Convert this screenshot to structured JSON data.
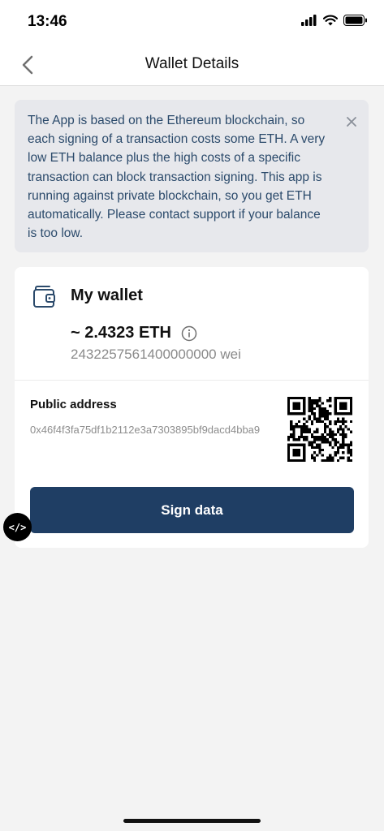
{
  "status_bar": {
    "time": "13:46"
  },
  "nav": {
    "title": "Wallet Details"
  },
  "banner": {
    "text": "The App is based on the Ethereum blockchain, so each signing of a transaction costs some ETH. A very low ETH balance plus the high costs of a specific transaction can block transaction signing. This app is running against private blockchain, so you get ETH automatically. Please contact support if your balance is too low."
  },
  "wallet": {
    "name": "My wallet",
    "balance_eth": "~ 2.4323 ETH",
    "balance_wei": "2432257561400000000 wei",
    "public_address_label": "Public address",
    "public_address": "0x46f4f3fa75df1b2112e3a7303895bf9dacd4bba9",
    "sign_button_label": "Sign data"
  },
  "dev_badge": {
    "label": "</>"
  },
  "colors": {
    "primary": "#1f3e64",
    "banner_bg": "#e7e8ec",
    "banner_text": "#2b4a6b",
    "page_bg": "#f3f3f3"
  }
}
